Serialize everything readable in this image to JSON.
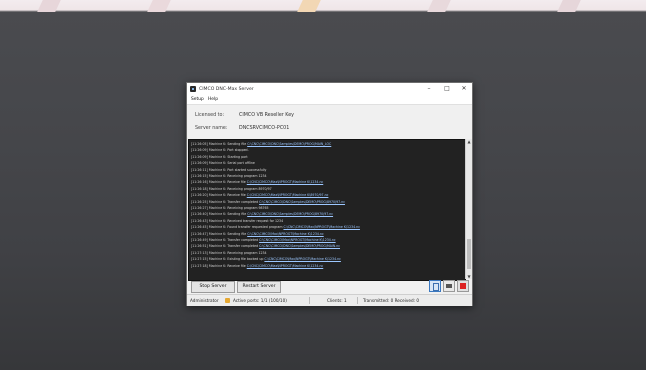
{
  "window": {
    "title": "CIMCO DNC-Max Server"
  },
  "menu": {
    "items": [
      "Setup",
      "Help"
    ]
  },
  "info": {
    "licensed_label": "Licensed to:",
    "licensed_value": "CIMCO VB Reseller Key",
    "server_label": "Server name:",
    "server_value": "DNCSRVCIMCO-PC01"
  },
  "log": {
    "lines": [
      {
        "ts": "[11:26:05] Machine K:",
        "msg": "Sending file",
        "path": "C:\\CNC\\CIMCO\\DNC\\Samples\\DEMO\\PROG\\MAIN_LOC"
      },
      {
        "ts": "[11:26:09] Machine K:",
        "msg": "Port stopped.",
        "path": ""
      },
      {
        "ts": "[11:26:09] Machine K:",
        "msg": "Starting port",
        "path": ""
      },
      {
        "ts": "[11:26:09] Machine K:",
        "msg": "Serial port offline",
        "path": ""
      },
      {
        "ts": "[11:26:11] Machine K:",
        "msg": "Port started successfully",
        "path": ""
      },
      {
        "ts": "[11:26:15] Machine K:",
        "msg": "Receiving program 1234",
        "path": ""
      },
      {
        "ts": "[11:26:16] Machine K:",
        "msg": "Receive file",
        "path": "C:\\CNC\\CIMCO\\Max\\NPROGT\\Machine K\\1234.nc"
      },
      {
        "ts": "[11:26:18] Machine K:",
        "msg": "Receiving program 8970/97",
        "path": ""
      },
      {
        "ts": "[11:26:20] Machine K:",
        "msg": "Receive file",
        "path": "C:\\CNC\\CIMCO\\Max\\NPROGT\\Machine K\\8970/97.nc"
      },
      {
        "ts": "[11:26:25] Machine K:",
        "msg": "Transfer completed",
        "path": "C:\\CNC\\CIMCO\\DNC\\Samples\\DEMO\\PROG\\8970/97.nc"
      },
      {
        "ts": "[11:26:27] Machine K:",
        "msg": "Receiving program 98765",
        "path": ""
      },
      {
        "ts": "[11:26:40] Machine K:",
        "msg": "Sending file",
        "path": "C:\\CNC\\CIMCO\\DNC\\Samples\\DEMO\\PROG\\8970/97.nc"
      },
      {
        "ts": "[11:26:43] Machine K:",
        "msg": "Received transfer request for 1234",
        "path": ""
      },
      {
        "ts": "[11:26:45] Machine K:",
        "msg": "Found transfer requested program",
        "path": "C:\\CNC\\CIMCO\\Max\\NPROGT\\Machine K\\1234.nc"
      },
      {
        "ts": "[11:26:47] Machine K:",
        "msg": "Sending file",
        "path": "C:\\CNC\\CIMCO\\Max\\NPROGT\\Machine K\\1234.nc"
      },
      {
        "ts": "[11:26:49] Machine K:",
        "msg": "Transfer completed",
        "path": "C:\\CNC\\CIMCO\\Max\\NPROGT\\Machine K\\1234.nc"
      },
      {
        "ts": "[11:26:51] Machine K:",
        "msg": "Transfer completed",
        "path": "C:\\CNC\\CIMCO\\DNC\\Samples\\DEMO\\PROG\\MAIN.nc"
      },
      {
        "ts": "[11:27:13] Machine K:",
        "msg": "Receiving program 1234",
        "path": ""
      },
      {
        "ts": "[11:27:15] Machine K:",
        "msg": "Existing file backed up",
        "path": "C:\\CNC\\CIMCO\\Max\\NPROGT\\Machine K\\1234.nc"
      },
      {
        "ts": "[11:27:18] Machine K:",
        "msg": "Receive file",
        "path": "C:\\CNC\\CIMCO\\Max\\NPROGT\\Machine K\\1234.nc"
      }
    ]
  },
  "buttons": {
    "stop": "Stop Server",
    "restart": "Restart Server"
  },
  "status": {
    "user": "Administrator",
    "active_ports": "Active ports: 1/1 (100/10)",
    "clients": "Clients: 1",
    "traffic": "Transmitted: 0 Received: 0"
  },
  "colors": {
    "log_background": "#222222",
    "link": "#9cc7ff",
    "close_tool": "#dd2222"
  }
}
